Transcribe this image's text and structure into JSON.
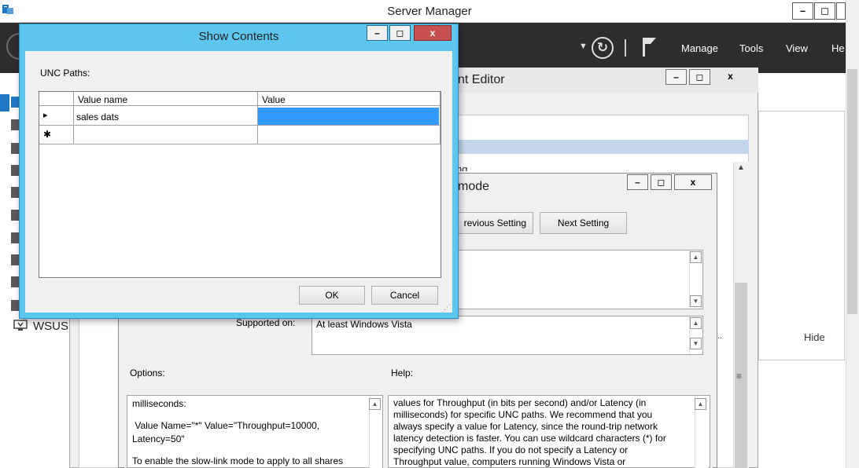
{
  "server_manager": {
    "title": "Server Manager",
    "menu": [
      "Manage",
      "Tools",
      "View",
      "He"
    ],
    "nav_items": [
      "WSUS"
    ],
    "hide_label": "Hide",
    "window_buttons": [
      "–",
      "◻",
      "x"
    ]
  },
  "editor": {
    "title_fragment": "nt Editor",
    "partial_row_text": "ng",
    "window_buttons": [
      "–",
      "◻",
      "x"
    ]
  },
  "policy_dialog": {
    "title_fragment": "mode",
    "window_buttons": [
      "–",
      "◻",
      "x"
    ],
    "previous_setting_fragment": "revious Setting",
    "next_setting": "Next Setting",
    "supported_on_label": "Supported on:",
    "supported_on_value": "At least Windows Vista",
    "options_label": "Options:",
    "help_label": "Help:",
    "options_lines": [
      "milliseconds:",
      "",
      " Value Name=\"*\" Value=\"Throughput=10000,",
      "Latency=50\"",
      "",
      "To enable the slow-link mode to apply to all shares"
    ],
    "help_lines": [
      "values for Throughput (in bits per second) and/or Latency (in",
      "milliseconds) for specific UNC paths. We recommend that you",
      "always specify a value for Latency, since the round-trip network",
      "latency detection is faster. You can use wildcard characters (*) for",
      "specifying UNC paths. If you do not specify a Latency or",
      "Throughput value, computers running Windows Vista or"
    ],
    "ellipsis": ".."
  },
  "show_contents": {
    "title": "Show Contents",
    "unc_label": "UNC Paths:",
    "columns": [
      "Value name",
      "Value"
    ],
    "rows": [
      {
        "marker": "▸",
        "name": "sales dats",
        "value": ""
      },
      {
        "marker": "✱",
        "name": "",
        "value": ""
      }
    ],
    "ok": "OK",
    "cancel": "Cancel",
    "window_buttons": [
      "–",
      "◻",
      "x"
    ]
  },
  "colors": {
    "dialog_accent": "#5cc6ef",
    "selection": "#3399ff",
    "close_red": "#c75050",
    "toolbar_dark": "#2d2d30"
  }
}
